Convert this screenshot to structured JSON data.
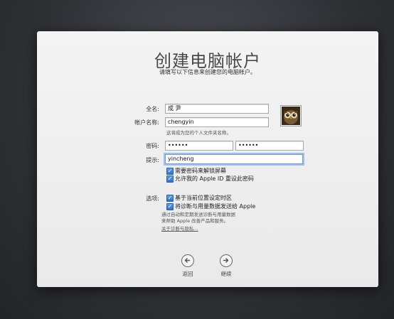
{
  "header": {
    "title": "创建电脑帐户",
    "subtitle": "请填写以下信息来创建您的电脑帐户。"
  },
  "form": {
    "full_name_label": "全名:",
    "full_name_value": "成 尹",
    "account_name_label": "帐户名称:",
    "account_name_value": "chengyin",
    "account_hint": "这将成为您的个人文件夹名称。",
    "password_label": "密码:",
    "password_value": "••••••",
    "verify_value": "••••••",
    "hint_label": "提示:",
    "hint_value": "yincheng",
    "require_password_label": "需要密码来解锁屏幕",
    "allow_appleid_label": "允许我的 Apple ID 重设此密码",
    "options_label": "选项:",
    "location_label": "基于当前位置设定时区",
    "diagnostics_label": "将诊断与用量数据发送给 Apple",
    "diagnostics_desc_1": "通过自动和定期发送诊断与用量数据",
    "diagnostics_desc_2": "来帮助 Apple 改善产品和服务。",
    "privacy_link": "关于诊断与隐私..."
  },
  "checkboxes": {
    "require_password": true,
    "allow_appleid": true,
    "location": true,
    "diagnostics": true
  },
  "avatar_icon": "owl-avatar-icon",
  "nav": {
    "back_label": "返回",
    "continue_label": "继续"
  }
}
